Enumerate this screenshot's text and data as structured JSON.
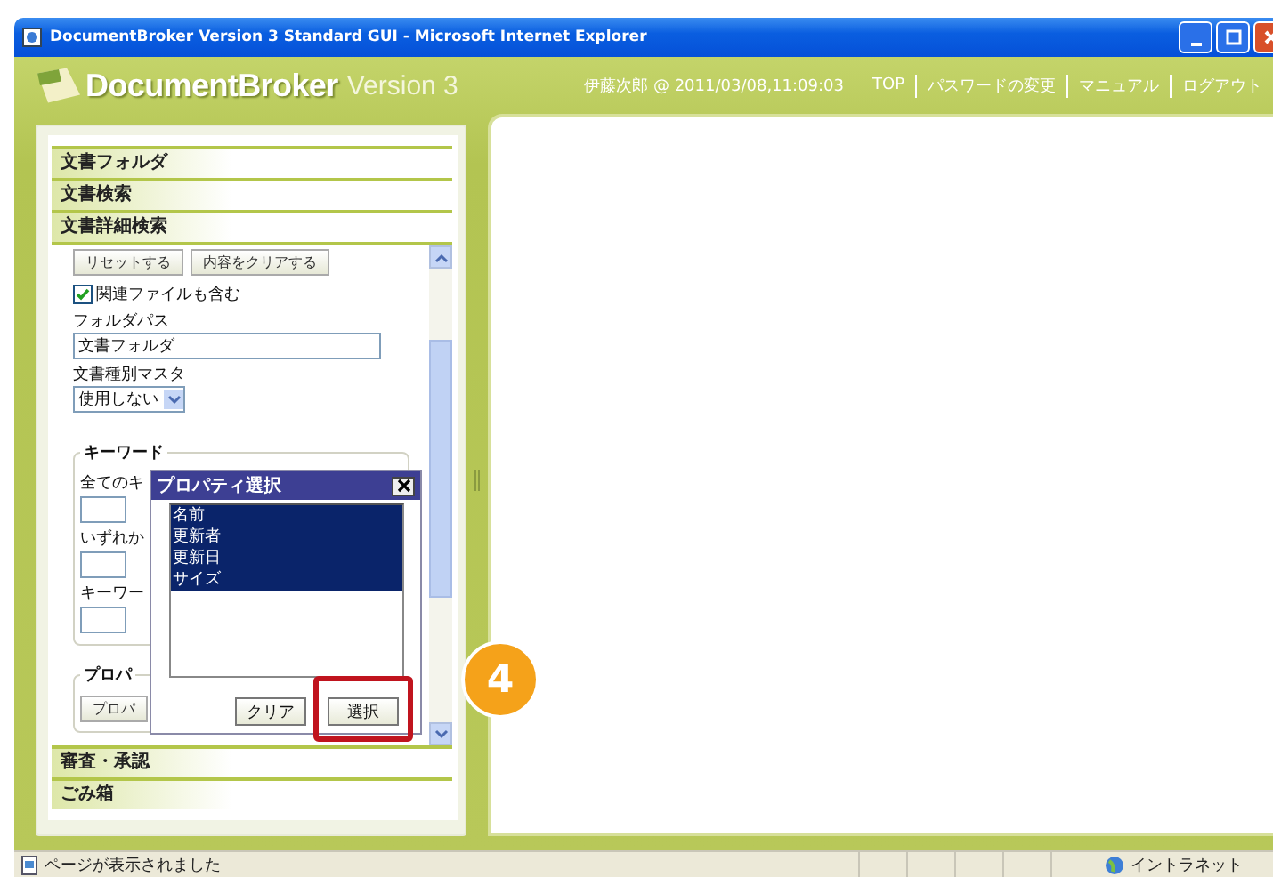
{
  "window": {
    "title": "DocumentBroker Version 3 Standard GUI - Microsoft Internet Explorer"
  },
  "header": {
    "logo_name": "DocumentBroker",
    "logo_version": "Version 3",
    "user_info": "伊藤次郎 @ 2011/03/08,11:09:03",
    "links": [
      "TOP",
      "パスワードの変更",
      "マニュアル",
      "ログアウト"
    ]
  },
  "sidebar": {
    "sections_top": [
      "文書フォルダ",
      "文書検索",
      "文書詳細検索"
    ],
    "buttons": [
      "リセットする",
      "内容をクリアする"
    ],
    "include_related": {
      "label": "関連ファイルも含む",
      "checked": true
    },
    "folder_path": {
      "label": "フォルダパス",
      "value": "文書フォルダ"
    },
    "doc_type": {
      "label": "文書種別マスタ",
      "value": "使用しない"
    },
    "keyword": {
      "legend": "キーワード",
      "labels": [
        "全てのキ",
        "いずれか",
        "キーワー"
      ]
    },
    "property": {
      "legend": "プロパ",
      "button": "プロパ"
    },
    "sections_bottom": [
      "審査・承認",
      "ごみ箱"
    ]
  },
  "dialog": {
    "title": "プロパティ選択",
    "items": [
      {
        "label": "名前",
        "selected": true
      },
      {
        "label": "更新者",
        "selected": true
      },
      {
        "label": "更新日",
        "selected": true
      },
      {
        "label": "サイズ",
        "selected": true
      }
    ],
    "buttons": [
      {
        "label": "クリア",
        "highlighted": false
      },
      {
        "label": "選択",
        "highlighted": true
      }
    ]
  },
  "step_badge": "4",
  "status_bar": {
    "message": "ページが表示されました",
    "zone": "イントラネット"
  }
}
